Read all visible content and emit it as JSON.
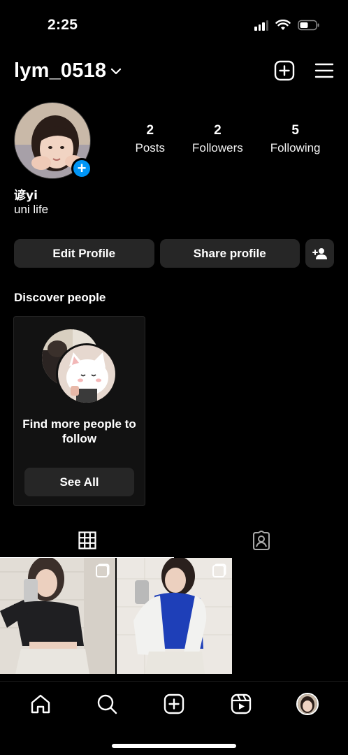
{
  "status_bar": {
    "time": "2:25"
  },
  "header": {
    "username": "lym_0518"
  },
  "profile": {
    "display_name": "谚yi",
    "bio": "uni life",
    "stats": [
      {
        "value": "2",
        "label": "Posts"
      },
      {
        "value": "2",
        "label": "Followers"
      },
      {
        "value": "5",
        "label": "Following"
      }
    ]
  },
  "actions": {
    "edit_label": "Edit Profile",
    "share_label": "Share profile"
  },
  "discover": {
    "title": "Discover people",
    "card_text": "Find more people to follow",
    "see_all_label": "See All"
  },
  "tabs": [
    {
      "icon": "grid-icon",
      "active": true
    },
    {
      "icon": "tagged-icon",
      "active": false
    }
  ],
  "posts": [
    {
      "type": "multi-photo"
    },
    {
      "type": "multi-photo"
    }
  ],
  "bottom_nav": [
    "home-icon",
    "search-icon",
    "create-icon",
    "reels-icon",
    "profile-avatar"
  ],
  "colors": {
    "accent": "#0095f6",
    "background": "#000000",
    "button": "#262626"
  }
}
